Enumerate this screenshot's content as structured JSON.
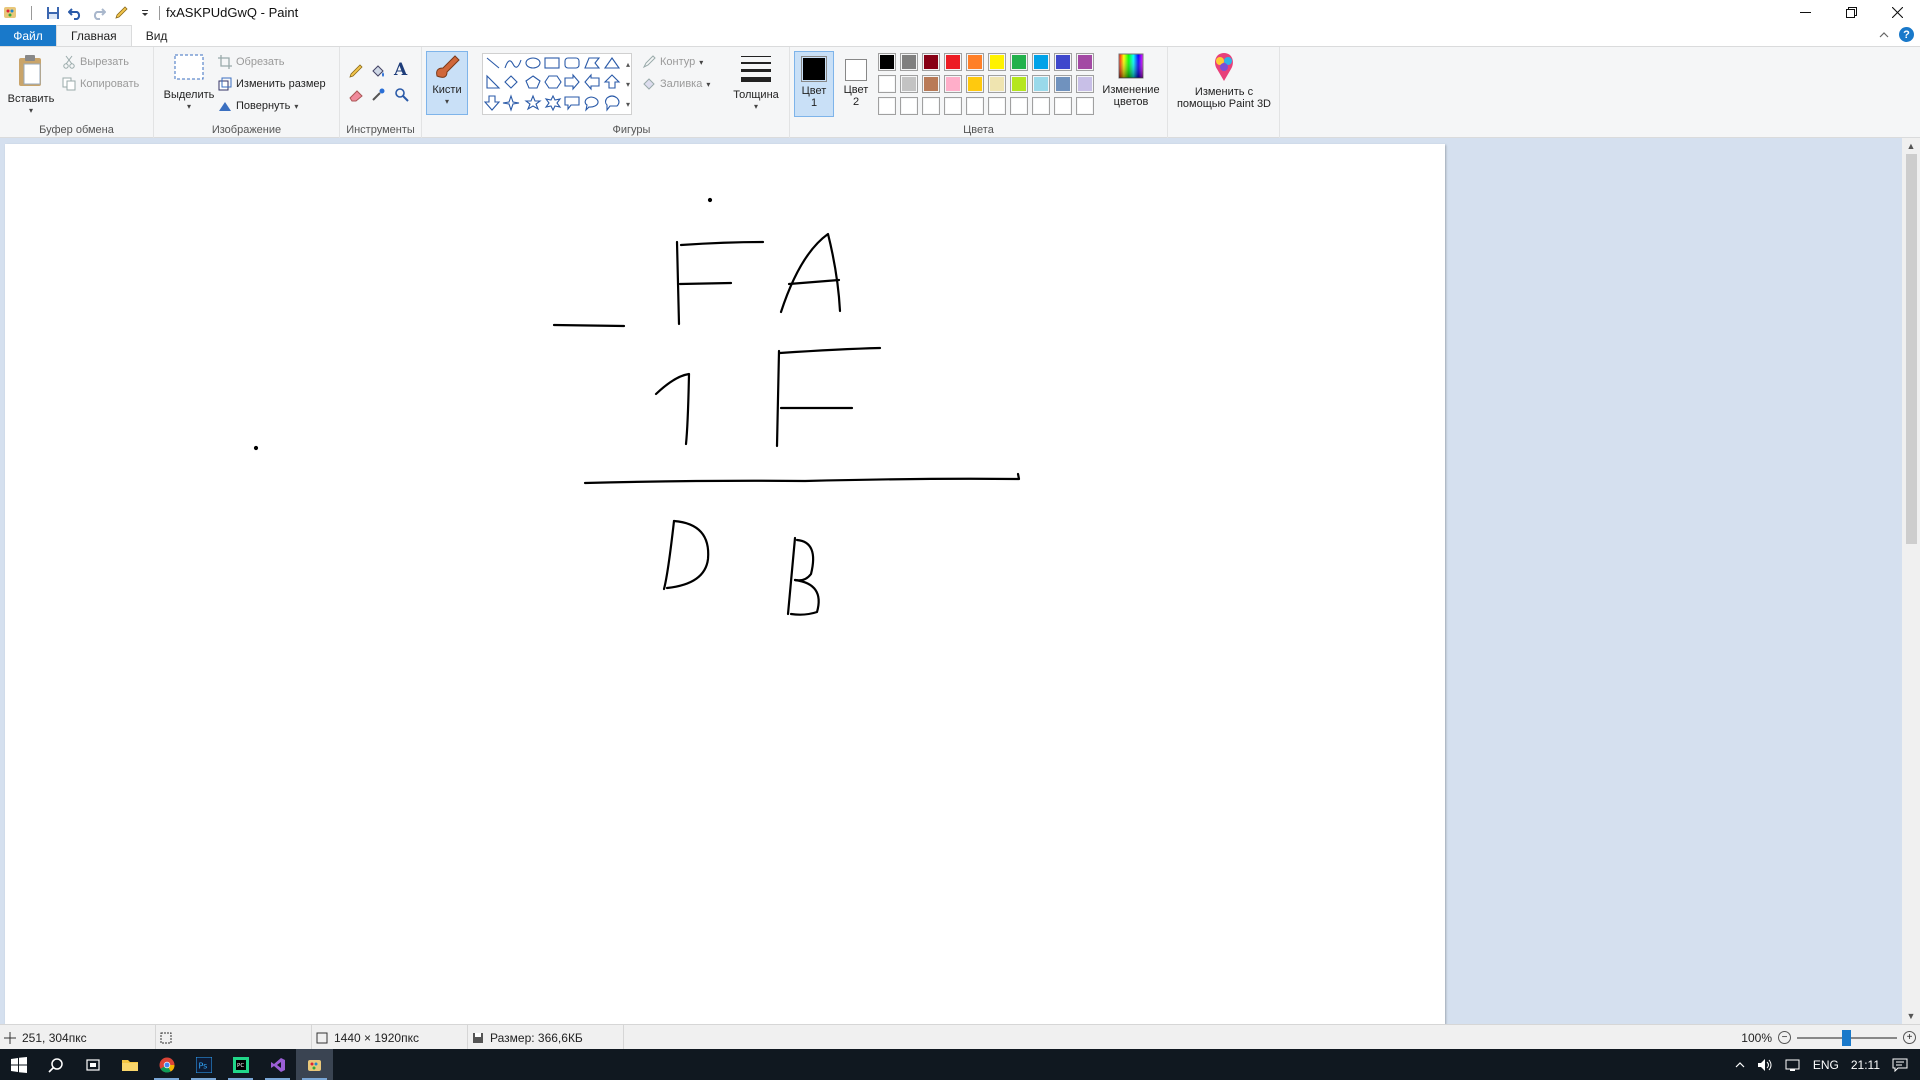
{
  "window": {
    "title": "fxASKPUdGwQ - Paint",
    "controls": [
      "minimize",
      "restore",
      "close"
    ]
  },
  "quick_access": [
    "paint-app-icon",
    "save-icon",
    "undo-icon",
    "redo-icon",
    "pencil-icon",
    "customize-dropdown-icon"
  ],
  "tabs": {
    "file": "Файл",
    "home": "Главная",
    "view": "Вид"
  },
  "ribbon": {
    "clipboard": {
      "label": "Буфер обмена",
      "paste": "Вставить",
      "cut": "Вырезать",
      "copy": "Копировать"
    },
    "image": {
      "label": "Изображение",
      "select": "Выделить",
      "crop": "Обрезать",
      "resize": "Изменить размер",
      "rotate": "Повернуть"
    },
    "tools": {
      "label": "Инструменты",
      "brushes": "Кисти"
    },
    "shapes": {
      "label": "Фигуры",
      "outline": "Контур",
      "fill": "Заливка"
    },
    "size": {
      "label": "Толщина"
    },
    "colors": {
      "label": "Цвета",
      "color1_a": "Цвет",
      "color1_b": "1",
      "color2_a": "Цвет",
      "color2_b": "2",
      "edit_a": "Изменение",
      "edit_b": "цветов",
      "paint3d_a": "Изменить с",
      "paint3d_b": "помощью Paint 3D",
      "color1": "#000000",
      "color2": "#ffffff",
      "palette_row1": [
        "#000000",
        "#7f7f7f",
        "#880015",
        "#ed1c24",
        "#ff7f27",
        "#fff200",
        "#22b14c",
        "#00a2e8",
        "#3f48cc",
        "#a349a4"
      ],
      "palette_row2": [
        "#ffffff",
        "#c3c3c3",
        "#b97a57",
        "#ffaec9",
        "#ffc90e",
        "#efe4b0",
        "#b5e61d",
        "#99d9ea",
        "#7092be",
        "#c8bfe7"
      ],
      "palette_row3": [
        "#ffffff",
        "#ffffff",
        "#ffffff",
        "#ffffff",
        "#ffffff",
        "#ffffff",
        "#ffffff",
        "#ffffff",
        "#ffffff",
        "#ffffff"
      ]
    }
  },
  "statusbar": {
    "cursor_pos": "251, 304пкс",
    "image_size": "1440 × 1920пкс",
    "file_size": "Размер: 366,6КБ",
    "zoom": "100%"
  },
  "taskbar": {
    "apps": [
      "start-icon",
      "search-icon",
      "task-view-icon",
      "file-explorer-icon",
      "chrome-icon",
      "photoshop-icon",
      "pycharm-icon",
      "visual-studio-icon",
      "paint-icon"
    ],
    "tray": {
      "language": "ENG",
      "time": "21:11"
    }
  }
}
